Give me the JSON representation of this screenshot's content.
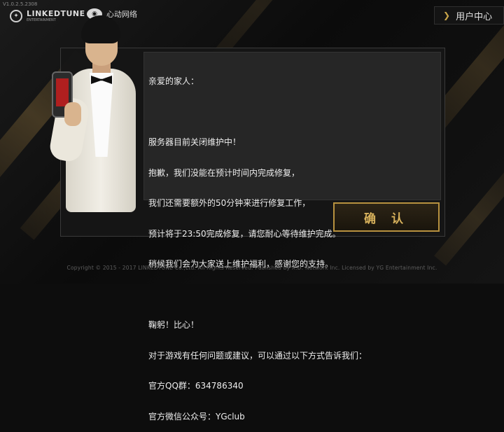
{
  "version": "V1.0.2.5.2308",
  "header": {
    "logo1": {
      "name": "LINKEDTUNE",
      "sub": "ENTERTAINMENT"
    },
    "logo2": {
      "name": "心动网络"
    },
    "user_center": {
      "label": "用户中心",
      "icon": "chevron-right-icon"
    }
  },
  "dialog": {
    "lines": [
      "亲爱的家人：",
      "",
      "服务器目前关闭维护中！",
      "抱歉，我们没能在预计时间内完成修复，",
      "我们还需要额外的50分钟来进行修复工作，",
      "预计将于23:50完成修复，请您耐心等待维护完成。",
      "稍候我们会为大家送上维护福利，感谢您的支持。",
      "",
      "鞠躬！比心！",
      "对于游戏有任何问题或建议，可以通过以下方式告诉我们：",
      "官方QQ群：634786340",
      "官方微信公众号：YGclub"
    ],
    "confirm_label": "确 认"
  },
  "footer": {
    "copyright": "Copyright © 2015 - 2017 LINKEDTUNE Co.,Ltd. All Rights Reserved. Published by X.D. Network Inc. Licensed by YG Entertainment Inc."
  },
  "colors": {
    "accent": "#c9a54a",
    "dialog_bg": "#161616",
    "text": "#ededed"
  }
}
